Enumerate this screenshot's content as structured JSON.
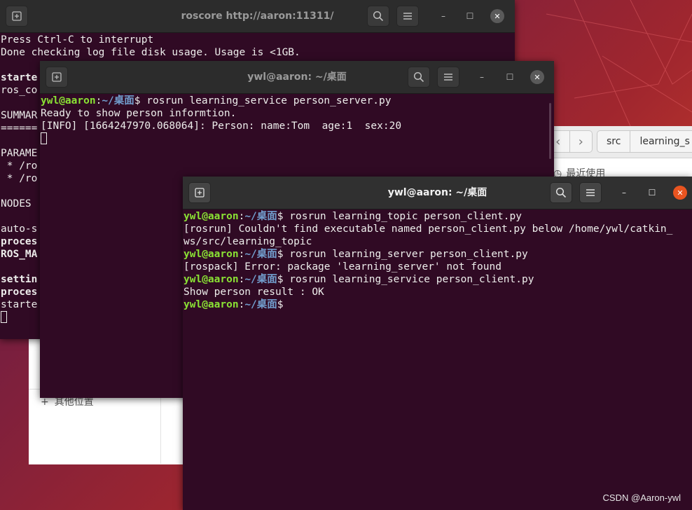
{
  "file_manager": {
    "breadcrumbs": [
      "src",
      "learning_s"
    ],
    "sidebar_recent": "最近使用",
    "sidebar_other": "其他位置"
  },
  "term1": {
    "title": "roscore http://aaron:11311/",
    "lines": [
      {
        "t": "Press Ctrl-C to interrupt"
      },
      {
        "t": "Done checking log file disk usage. Usage is <1GB."
      },
      {
        "t": ""
      },
      {
        "t": "starte",
        "b": true
      },
      {
        "t": "ros_co"
      },
      {
        "t": ""
      },
      {
        "t": "SUMMAR"
      },
      {
        "t": "======"
      },
      {
        "t": ""
      },
      {
        "t": "PARAME"
      },
      {
        "t": " * /ro"
      },
      {
        "t": " * /ro"
      },
      {
        "t": ""
      },
      {
        "t": "NODES"
      },
      {
        "t": ""
      },
      {
        "t": "auto-s"
      },
      {
        "t": "proces",
        "b": true
      },
      {
        "t": "ROS_MA",
        "b": true
      },
      {
        "t": ""
      },
      {
        "t": "settin",
        "b": true
      },
      {
        "t": "proces",
        "b": true
      },
      {
        "t": "starte"
      }
    ]
  },
  "term2": {
    "title": "ywl@aaron: ~/桌面",
    "prompt_user": "ywl@aaron",
    "prompt_path": "~/桌面",
    "command": "rosrun learning_service person_server.py",
    "output": [
      "Ready to show person informtion.",
      "[INFO] [1664247970.068064]: Person: name:Tom  age:1  sex:20"
    ]
  },
  "term3": {
    "title": "ywl@aaron: ~/桌面",
    "prompt_user": "ywl@aaron",
    "prompt_path": "~/桌面",
    "lines": [
      {
        "cmd": "rosrun learning_topic person_client.py"
      },
      {
        "out": "[rosrun] Couldn't find executable named person_client.py below /home/ywl/catkin_"
      },
      {
        "out": "ws/src/learning_topic"
      },
      {
        "cmd": "rosrun learning_server person_client.py"
      },
      {
        "out": "[rospack] Error: package 'learning_server' not found"
      },
      {
        "cmd": "rosrun learning_service person_client.py"
      },
      {
        "out": "Show person result : OK"
      },
      {
        "cmd": ""
      }
    ]
  },
  "watermark": "CSDN @Aaron-ywl",
  "colors": {
    "terminal_bg": "#300a24",
    "prompt_user": "#8ae234",
    "prompt_path": "#729fcf",
    "close_active": "#e95420"
  },
  "icons": {
    "new_tab": "new-tab-icon",
    "search": "search-icon",
    "menu": "hamburger-menu-icon",
    "minimize": "minimize-icon",
    "maximize": "maximize-icon",
    "close": "close-icon"
  }
}
